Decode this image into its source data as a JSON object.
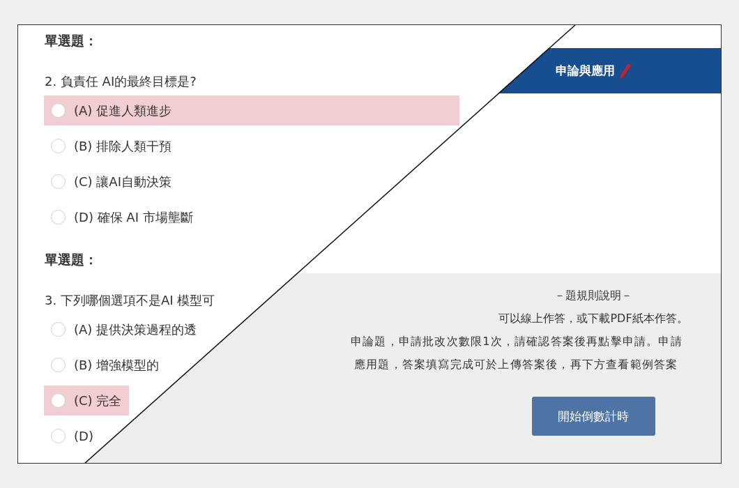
{
  "left_panel": {
    "sections": [
      {
        "heading": "單選題：",
        "question": "2. 負責任 AI的最終目標是?",
        "options": [
          {
            "label": "(A) 促進人類進步",
            "highlighted": true
          },
          {
            "label": "(B) 排除人類干預",
            "highlighted": false
          },
          {
            "label": "(C) 讓AI自動決策",
            "highlighted": false
          },
          {
            "label": "(D) 確保 AI 市場壟斷",
            "highlighted": false
          }
        ]
      },
      {
        "heading": "單選題：",
        "question": "3. 下列哪個選項不是AI 模型可",
        "options": [
          {
            "label": "(A) 提供決策過程的透",
            "highlighted": false
          },
          {
            "label": "(B) 增強模型的",
            "highlighted": false
          },
          {
            "label": "(C) 完全",
            "highlighted": true
          },
          {
            "label": "(D)",
            "highlighted": false
          }
        ]
      }
    ]
  },
  "right_panel": {
    "title": "申論與應用",
    "rules_title": "－題規則說明－",
    "rules": [
      "可以線上作答，或下載PDF紙本作答。",
      "申論題，申請批改次數限1次，請確認答案後再點擊申請。申請",
      "應用題，答案填寫完成可於上傳答案後，再下方查看範例答案"
    ],
    "start_button": "開始倒數計時"
  }
}
